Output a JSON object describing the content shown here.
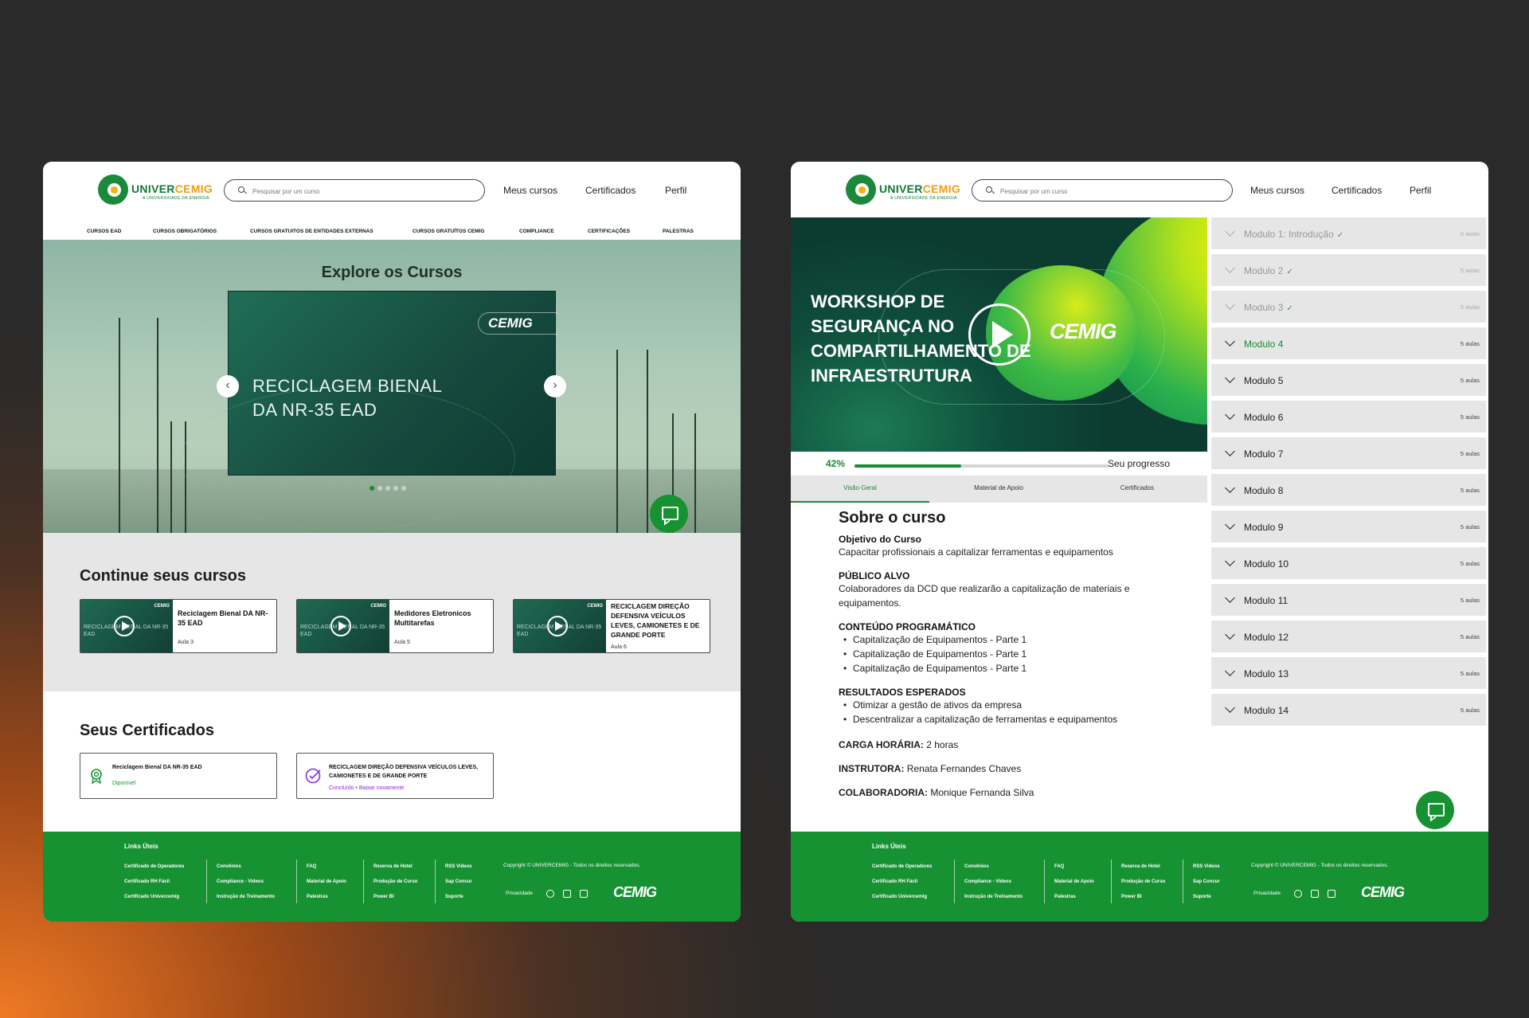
{
  "brand": {
    "name_a": "UNIVER",
    "name_b": "CEMIG",
    "tagline": "A UNIVERSIDADE DA ENERGIA",
    "cemig": "CEMIG"
  },
  "search": {
    "placeholder": "Pesquisar por um curso"
  },
  "nav": {
    "courses": "Meus cursos",
    "certificates": "Certificados",
    "profile": "Perfil"
  },
  "categories": [
    "CURSOS EAD",
    "CURSOS OBRIGATÓRIOS",
    "CURSOS GRATUITOS DE ENTIDADES EXTERNAS",
    "CURSOS GRATUÍTOS CEMIG",
    "COMPLIANCE",
    "CERTIFICAÇÕES",
    "PALESTRAS"
  ],
  "hero": {
    "title": "Explore os Cursos",
    "banner_line1": "RECICLAGEM BIENAL",
    "banner_line2": "DA NR-35 EAD",
    "carousel_active": 1,
    "carousel_count": 5
  },
  "continue": {
    "title": "Continue seus cursos",
    "items": [
      {
        "name": "Reciclagem Bienal DA NR-35 EAD",
        "lesson": "Aula 3",
        "thumb": "RECICLAGEM BIENAL DA NR-35 EAD"
      },
      {
        "name": "Medidores Eletronicos Multitarefas",
        "lesson": "Aula 5",
        "thumb": "RECICLAGEM BIENAL DA NR-35 EAD"
      },
      {
        "name": "RECICLAGEM DIREÇÃO DEFENSIVA VEÍCULOS LEVES, CAMIONETES E DE GRANDE PORTE",
        "lesson": "Aula 6",
        "thumb": "RECICLAGEM BIENAL DA NR-35 EAD"
      }
    ]
  },
  "certificates": {
    "title": "Seus Certificados",
    "items": [
      {
        "name": "Reciclagem Bienal DA NR-35 EAD",
        "status": "Diponível"
      },
      {
        "name": "RECICLAGEM DIREÇÃO DEFENSIVA VEÍCULOS LEVES, CAMIONETES E DE GRANDE PORTE",
        "status": "Concluído",
        "sep": "•",
        "action": "Baixar novamente"
      }
    ]
  },
  "footer": {
    "title": "Links Úteis",
    "col1": [
      "Certificado de Operadores",
      "Certificado RH Fácil",
      "Certificado Univercemig"
    ],
    "col2": [
      "Convênios",
      "Compliance - Videos",
      "Instrução de Treinamento"
    ],
    "col3": [
      "FAQ",
      "Material de Apoio",
      "Palestras"
    ],
    "col4": [
      "Reserva de Hotel",
      "Produção de Curso",
      "Power BI"
    ],
    "col5": [
      "RSS Videos",
      "Sap Concur",
      "Suporte"
    ],
    "copyright": "Copyright © UNIVERCEMIG - Todos os direitos reservados.",
    "privacy": "Privacidade",
    "logo": "CEMIG"
  },
  "course": {
    "video_title": "WORKSHOP DE SEGURANÇA NO COMPARTILHAMENTO DE INFRAESTRUTURA",
    "progress_pct": "42%",
    "progress_value": 0.42,
    "progress_label": "Seu progresso",
    "tabs": [
      "Visão Geral",
      "Material de Apoio",
      "Certificados"
    ],
    "about_title": "Sobre o curso",
    "objective_label": "Objetivo do Curso",
    "objective": "Capacitar profissionais a capitalizar ferramentas e equipamentos",
    "audience_label": "PÚBLICO ALVO",
    "audience": "Colaboradores da DCD que realizarão a capitalização de materiais e equipamentos.",
    "content_label": "CONTEÚDO PROGRAMÁTICO",
    "content": [
      "Capitalização de Equipamentos - Parte 1",
      "Capitalização de Equipamentos - Parte 1",
      "Capitalização de Equipamentos - Parte 1"
    ],
    "results_label": "RESULTADOS ESPERADOS",
    "results": [
      "Otimizar a gestão de ativos da empresa",
      "Descentralizar a capitalização de ferramentas e equipamentos"
    ],
    "hours_label": "CARGA HORÁRIA:",
    "hours": "2 horas",
    "instructor_label": "INSTRUTORA:",
    "instructor": "Renata Fernandes Chaves",
    "collab_label": "COLABORADORIA:",
    "collab": "Monique Fernanda Silva"
  },
  "modules": [
    {
      "name": "Modulo 1: Introdução",
      "lessons": "5 aulas",
      "state": "done"
    },
    {
      "name": "Modulo 2",
      "lessons": "5 aulas",
      "state": "done"
    },
    {
      "name": "Modulo 3",
      "lessons": "5 aulas",
      "state": "done"
    },
    {
      "name": "Modulo 4",
      "lessons": "5 aulas",
      "state": "active"
    },
    {
      "name": "Modulo 5",
      "lessons": "5 aulas",
      "state": "todo"
    },
    {
      "name": "Modulo 6",
      "lessons": "5 aulas",
      "state": "todo"
    },
    {
      "name": "Modulo 7",
      "lessons": "5 aulas",
      "state": "todo"
    },
    {
      "name": "Modulo 8",
      "lessons": "5 aulas",
      "state": "todo"
    },
    {
      "name": "Modulo 9",
      "lessons": "5 aulas",
      "state": "todo"
    },
    {
      "name": "Modulo 10",
      "lessons": "5 aulas",
      "state": "todo"
    },
    {
      "name": "Modulo 11",
      "lessons": "5 aulas",
      "state": "todo"
    },
    {
      "name": "Modulo 12",
      "lessons": "5 aulas",
      "state": "todo"
    },
    {
      "name": "Modulo 13",
      "lessons": "5 aulas",
      "state": "todo"
    },
    {
      "name": "Modulo 14",
      "lessons": "5 aulas",
      "state": "todo"
    }
  ],
  "colors": {
    "primary_green": "#169232",
    "accent_orange": "#f39c12",
    "done_gray": "#999999"
  }
}
